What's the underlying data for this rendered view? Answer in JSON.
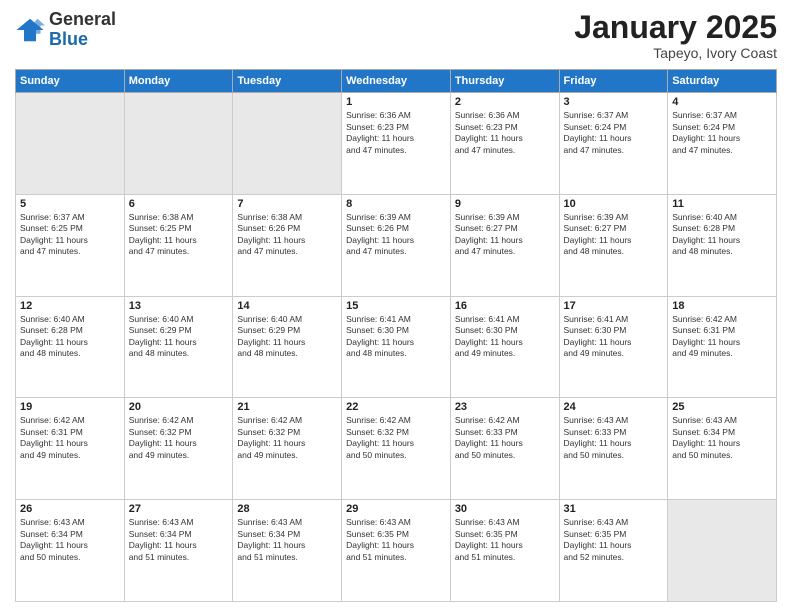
{
  "logo": {
    "general": "General",
    "blue": "Blue"
  },
  "header": {
    "month": "January 2025",
    "location": "Tapeyo, Ivory Coast"
  },
  "days_of_week": [
    "Sunday",
    "Monday",
    "Tuesday",
    "Wednesday",
    "Thursday",
    "Friday",
    "Saturday"
  ],
  "weeks": [
    [
      {
        "day": "",
        "info": ""
      },
      {
        "day": "",
        "info": ""
      },
      {
        "day": "",
        "info": ""
      },
      {
        "day": "1",
        "info": "Sunrise: 6:36 AM\nSunset: 6:23 PM\nDaylight: 11 hours\nand 47 minutes."
      },
      {
        "day": "2",
        "info": "Sunrise: 6:36 AM\nSunset: 6:23 PM\nDaylight: 11 hours\nand 47 minutes."
      },
      {
        "day": "3",
        "info": "Sunrise: 6:37 AM\nSunset: 6:24 PM\nDaylight: 11 hours\nand 47 minutes."
      },
      {
        "day": "4",
        "info": "Sunrise: 6:37 AM\nSunset: 6:24 PM\nDaylight: 11 hours\nand 47 minutes."
      }
    ],
    [
      {
        "day": "5",
        "info": "Sunrise: 6:37 AM\nSunset: 6:25 PM\nDaylight: 11 hours\nand 47 minutes."
      },
      {
        "day": "6",
        "info": "Sunrise: 6:38 AM\nSunset: 6:25 PM\nDaylight: 11 hours\nand 47 minutes."
      },
      {
        "day": "7",
        "info": "Sunrise: 6:38 AM\nSunset: 6:26 PM\nDaylight: 11 hours\nand 47 minutes."
      },
      {
        "day": "8",
        "info": "Sunrise: 6:39 AM\nSunset: 6:26 PM\nDaylight: 11 hours\nand 47 minutes."
      },
      {
        "day": "9",
        "info": "Sunrise: 6:39 AM\nSunset: 6:27 PM\nDaylight: 11 hours\nand 47 minutes."
      },
      {
        "day": "10",
        "info": "Sunrise: 6:39 AM\nSunset: 6:27 PM\nDaylight: 11 hours\nand 48 minutes."
      },
      {
        "day": "11",
        "info": "Sunrise: 6:40 AM\nSunset: 6:28 PM\nDaylight: 11 hours\nand 48 minutes."
      }
    ],
    [
      {
        "day": "12",
        "info": "Sunrise: 6:40 AM\nSunset: 6:28 PM\nDaylight: 11 hours\nand 48 minutes."
      },
      {
        "day": "13",
        "info": "Sunrise: 6:40 AM\nSunset: 6:29 PM\nDaylight: 11 hours\nand 48 minutes."
      },
      {
        "day": "14",
        "info": "Sunrise: 6:40 AM\nSunset: 6:29 PM\nDaylight: 11 hours\nand 48 minutes."
      },
      {
        "day": "15",
        "info": "Sunrise: 6:41 AM\nSunset: 6:30 PM\nDaylight: 11 hours\nand 48 minutes."
      },
      {
        "day": "16",
        "info": "Sunrise: 6:41 AM\nSunset: 6:30 PM\nDaylight: 11 hours\nand 49 minutes."
      },
      {
        "day": "17",
        "info": "Sunrise: 6:41 AM\nSunset: 6:30 PM\nDaylight: 11 hours\nand 49 minutes."
      },
      {
        "day": "18",
        "info": "Sunrise: 6:42 AM\nSunset: 6:31 PM\nDaylight: 11 hours\nand 49 minutes."
      }
    ],
    [
      {
        "day": "19",
        "info": "Sunrise: 6:42 AM\nSunset: 6:31 PM\nDaylight: 11 hours\nand 49 minutes."
      },
      {
        "day": "20",
        "info": "Sunrise: 6:42 AM\nSunset: 6:32 PM\nDaylight: 11 hours\nand 49 minutes."
      },
      {
        "day": "21",
        "info": "Sunrise: 6:42 AM\nSunset: 6:32 PM\nDaylight: 11 hours\nand 49 minutes."
      },
      {
        "day": "22",
        "info": "Sunrise: 6:42 AM\nSunset: 6:32 PM\nDaylight: 11 hours\nand 50 minutes."
      },
      {
        "day": "23",
        "info": "Sunrise: 6:42 AM\nSunset: 6:33 PM\nDaylight: 11 hours\nand 50 minutes."
      },
      {
        "day": "24",
        "info": "Sunrise: 6:43 AM\nSunset: 6:33 PM\nDaylight: 11 hours\nand 50 minutes."
      },
      {
        "day": "25",
        "info": "Sunrise: 6:43 AM\nSunset: 6:34 PM\nDaylight: 11 hours\nand 50 minutes."
      }
    ],
    [
      {
        "day": "26",
        "info": "Sunrise: 6:43 AM\nSunset: 6:34 PM\nDaylight: 11 hours\nand 50 minutes."
      },
      {
        "day": "27",
        "info": "Sunrise: 6:43 AM\nSunset: 6:34 PM\nDaylight: 11 hours\nand 51 minutes."
      },
      {
        "day": "28",
        "info": "Sunrise: 6:43 AM\nSunset: 6:34 PM\nDaylight: 11 hours\nand 51 minutes."
      },
      {
        "day": "29",
        "info": "Sunrise: 6:43 AM\nSunset: 6:35 PM\nDaylight: 11 hours\nand 51 minutes."
      },
      {
        "day": "30",
        "info": "Sunrise: 6:43 AM\nSunset: 6:35 PM\nDaylight: 11 hours\nand 51 minutes."
      },
      {
        "day": "31",
        "info": "Sunrise: 6:43 AM\nSunset: 6:35 PM\nDaylight: 11 hours\nand 52 minutes."
      },
      {
        "day": "",
        "info": ""
      }
    ]
  ]
}
